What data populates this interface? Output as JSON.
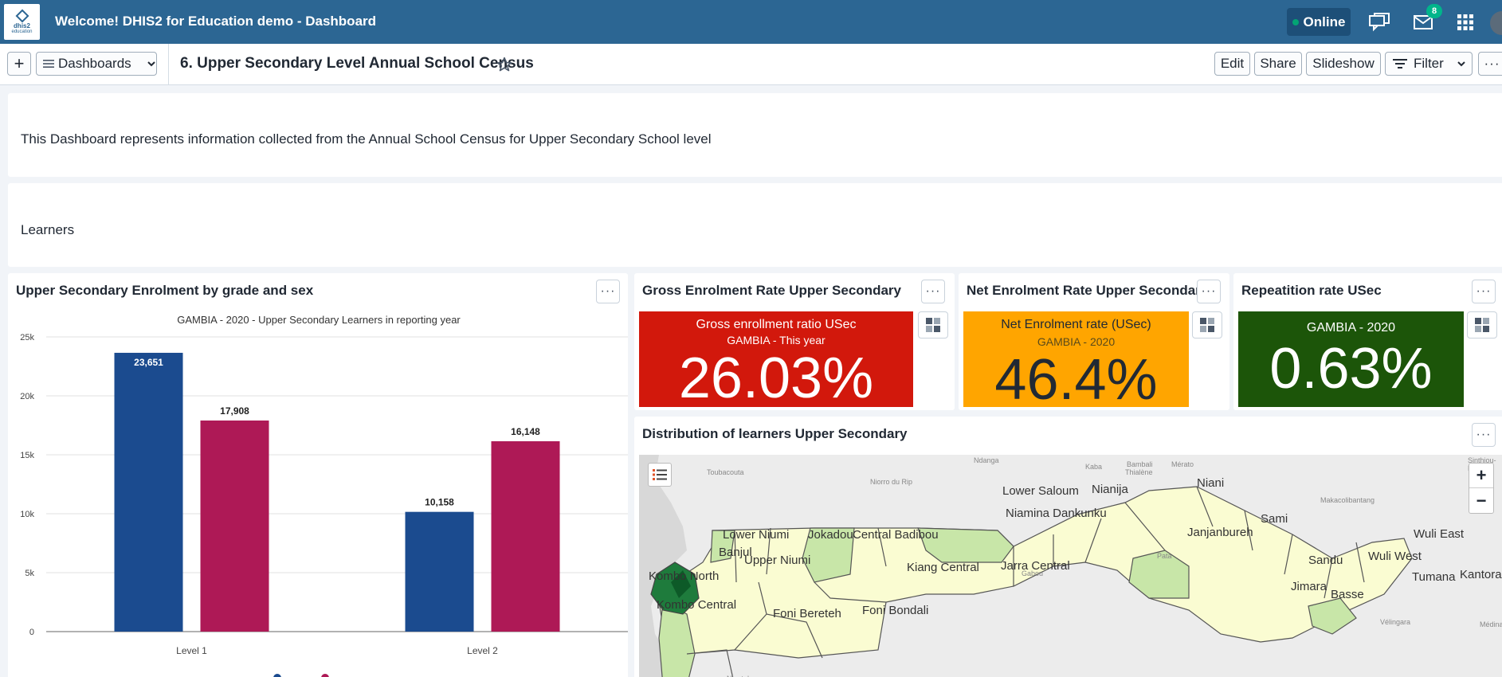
{
  "header": {
    "logo_top": "dhis2",
    "logo_bottom": "education",
    "title": "Welcome! DHIS2 for Education demo - Dashboard",
    "online_label": "Online",
    "messages_badge": "8"
  },
  "dashbar": {
    "add_label": "+",
    "dashboards_label": "Dashboards",
    "title": "6. Upper Secondary Level Annual School Census",
    "edit_label": "Edit",
    "share_label": "Share",
    "slideshow_label": "Slideshow",
    "filter_label": "Filter",
    "more_label": "···"
  },
  "text_items": {
    "intro": "This Dashboard represents information collected from the Annual School Census for Upper Secondary School level",
    "learners": "Learners"
  },
  "enrolment_chart": {
    "title": "Upper Secondary Enrolment by grade and sex",
    "menu": "···"
  },
  "gross_rate": {
    "title": "Gross Enrolment Rate Upper Secondary",
    "line1": "Gross enrollment ratio USec",
    "line2": "GAMBIA - This year",
    "value": "26.03%",
    "color": "#d2180c",
    "menu": "···"
  },
  "net_rate": {
    "title": "Net Enrolment Rate Upper Secondary",
    "line1": "Net Enrolment rate (USec)",
    "line2": "GAMBIA - 2020",
    "value": "46.4%",
    "color": "#ffa500",
    "menu": "···"
  },
  "repetition_rate": {
    "title": "Repeatition rate USec",
    "line1": "GAMBIA - 2020",
    "value": "0.63%",
    "color": "#1c5509",
    "menu": "···"
  },
  "map": {
    "title": "Distribution of learners Upper Secondary",
    "menu": "···",
    "zoom_in": "+",
    "zoom_out": "−",
    "place_names": [
      "Ndanga",
      "Kaba",
      "Bambali",
      "Thialène",
      "Mérato",
      "Toubacouta",
      "Niorro du Rip",
      "Sinthiou-Maleme",
      "Makacolibantang",
      "Pata",
      "Vélingara",
      "Médina C",
      "Gabou",
      "Ningtabo"
    ],
    "regions": [
      "Lower Saloum",
      "Nianija",
      "Niani",
      "Niamina Dankunku",
      "Sami",
      "Janjanbureh",
      "Wuli East",
      "Lower Niumi",
      "Jokadou",
      "Central Badibou",
      "Banjul",
      "Upper Niumi",
      "Kiang Central",
      "Jarra Central",
      "Sandu",
      "Wuli West",
      "Kombo North",
      "Kantora",
      "Tumana",
      "Jimara",
      "Basse",
      "Kombo Central",
      "Foni Bereteh",
      "Foni Bondali"
    ]
  },
  "chart_data": {
    "type": "bar",
    "title": "GAMBIA - 2020 - Upper Secondary Learners in reporting year",
    "xlabel": "",
    "ylabel": "",
    "categories": [
      "Level 1",
      "Level 2"
    ],
    "series": [
      {
        "values": [
          23651,
          10158
        ],
        "color": "#1b4b8f"
      },
      {
        "values": [
          17908,
          16148
        ],
        "color": "#ae1956"
      }
    ],
    "data_labels": [
      "23,651",
      "10,158",
      "17,908",
      "16,148"
    ],
    "ylim": [
      0,
      25000
    ],
    "yticks": [
      0,
      5000,
      10000,
      15000,
      20000,
      25000
    ],
    "ytick_labels": [
      "0",
      "5k",
      "10k",
      "15k",
      "20k",
      "25k"
    ],
    "grid": true,
    "legend": "bottom"
  }
}
